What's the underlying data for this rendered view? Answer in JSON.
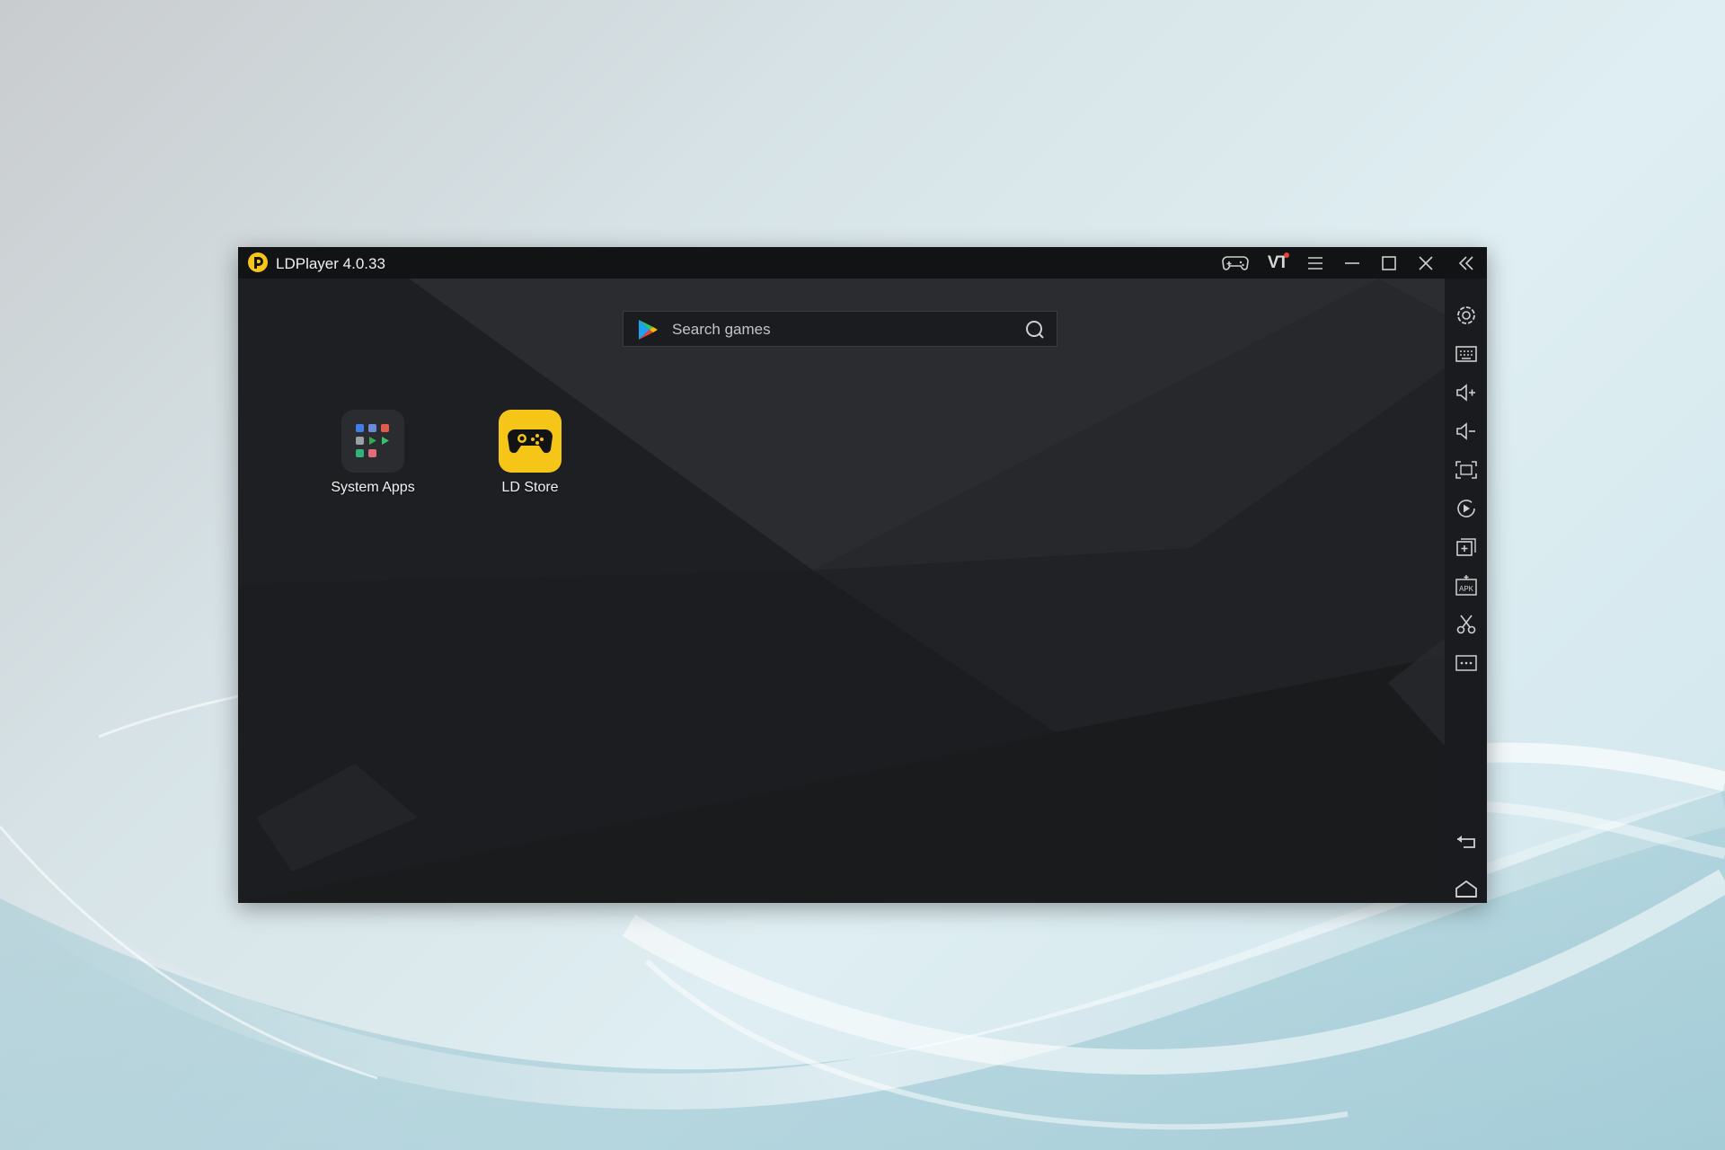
{
  "window": {
    "title": "LDPlayer 4.0.33",
    "accent": "#f5c518",
    "titlebar_buttons": [
      "gamepad-icon",
      "vt-icon",
      "menu-icon",
      "minimize-icon",
      "maximize-icon",
      "close-icon",
      "collapse-sidebar-icon"
    ],
    "vt_label": "VT"
  },
  "search": {
    "placeholder": "Search games"
  },
  "desktop": {
    "apps": [
      {
        "label": "System Apps",
        "icon": "system-apps-icon"
      },
      {
        "label": "LD Store",
        "icon": "ld-store-icon"
      }
    ]
  },
  "sidebar": {
    "items": [
      "settings-icon",
      "keyboard-mapping-icon",
      "volume-up-icon",
      "volume-down-icon",
      "fullscreen-icon",
      "record-icon",
      "multi-instance-icon",
      "install-apk-icon",
      "screenshot-scissors-icon",
      "more-icon",
      "back-icon",
      "home-icon"
    ],
    "apk_label": "APK"
  }
}
